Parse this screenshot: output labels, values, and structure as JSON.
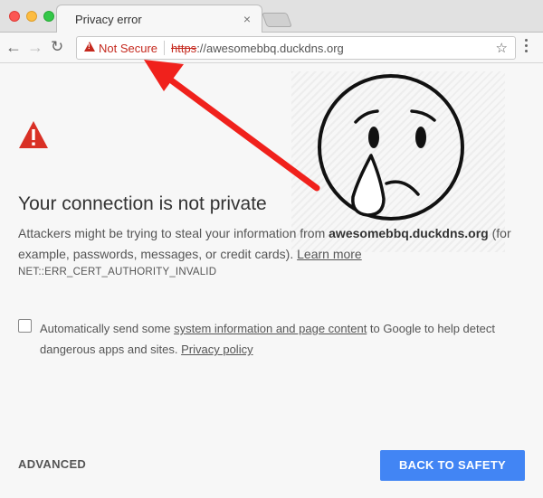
{
  "tab": {
    "title": "Privacy error",
    "close": "×"
  },
  "toolbar": {
    "back": "←",
    "forward": "→",
    "reload": "↻",
    "not_secure": "Not Secure",
    "url_scheme": "https",
    "url_rest": "://awesomebbq.duckdns.org",
    "star": "☆"
  },
  "page": {
    "heading": "Your connection is not private",
    "para_prefix": "Attackers might be trying to steal your information from ",
    "domain": "awesomebbq.duckdns.org",
    "para_suffix": " (for example, passwords, messages, or credit cards). ",
    "learn_more": "Learn more",
    "error_code": "NET::ERR_CERT_AUTHORITY_INVALID",
    "checkbox_prefix": "Automatically send some ",
    "checkbox_link": "system information and page content",
    "checkbox_middle": " to Google to help detect dangerous apps and sites. ",
    "privacy_link": "Privacy policy",
    "advanced": "ADVANCED",
    "back_to_safety": "BACK TO SAFETY"
  },
  "colors": {
    "danger": "#c5291e",
    "button": "#4285f4",
    "annotation_arrow": "#f0211c"
  },
  "icons": [
    "warning-triangle-icon",
    "sad-face-annotation-icon",
    "red-arrow-annotation-icon"
  ]
}
